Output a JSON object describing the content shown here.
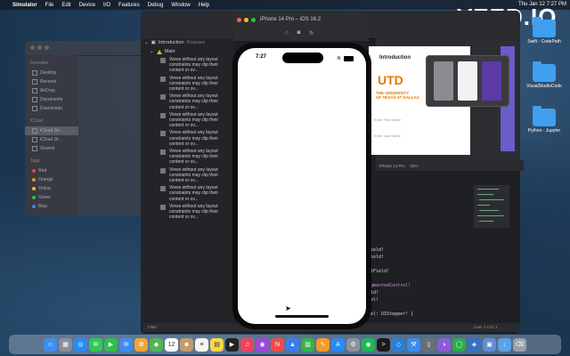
{
  "menubar": {
    "app": "Simulator",
    "items": [
      "File",
      "Edit",
      "Device",
      "I/O",
      "Features",
      "Debug",
      "Window",
      "Help"
    ],
    "datetime": "Thu Jan 12  7:27 PM"
  },
  "watermark": "VEED.IO",
  "finder": {
    "sections": [
      {
        "title": "Favorites",
        "items": [
          "Desktop",
          "Recents",
          "AirDrop",
          "Documents",
          "Downloads"
        ]
      },
      {
        "title": "iCloud",
        "items": [
          "iCloud Dri...",
          "iCloud Dr...",
          "Shared"
        ]
      },
      {
        "title": "Tags",
        "items": [
          "Red",
          "Orange",
          "Yellow",
          "Green",
          "Blue"
        ]
      }
    ],
    "tag_colors": [
      "#e5484d",
      "#f08a24",
      "#e6c229",
      "#3fb950",
      "#3b82f6"
    ]
  },
  "simulator": {
    "title": "iPhone 14 Pro – iOS 16.2",
    "status_time": "7:27"
  },
  "xcode": {
    "issues_header": "Introduction",
    "issues_count": "9 issues",
    "group": "Main",
    "issue_text": "Views without any layout constraints may clip their content or ov...",
    "issue_count_display": 9,
    "preview": {
      "title": "Introduction",
      "logo": "UTD",
      "logo_sub1": "THE UNIVERSITY",
      "logo_sub2": "OF TEXAS AT DALLAS",
      "field1": "Enter First Name",
      "field2": "Enter Last Name"
    },
    "canvas_bar": {
      "device": "iPhone 14 Pro",
      "zoom": "53%"
    },
    "code_lines": [
      "ield!",
      "ield!",
      "tField!",
      "gmentedControl!",
      "ld!",
      "el!",
      "el: UIStepper! {"
    ],
    "statusbar": {
      "filter": "Filter",
      "position": "Line: 1  Col: 1"
    }
  },
  "desktop": [
    {
      "label": "Swift - CodePath"
    },
    {
      "label": "VisualStudioCode"
    },
    {
      "label": "Python - Jupyter"
    }
  ],
  "dock": {
    "apps": [
      {
        "name": "Finder",
        "color": "#3d8ef0",
        "glyph": "☺"
      },
      {
        "name": "Launchpad",
        "color": "#8a8f99",
        "glyph": "▦"
      },
      {
        "name": "Safari",
        "color": "#2a8bf2",
        "glyph": "◎"
      },
      {
        "name": "Messages",
        "color": "#34c759",
        "glyph": "✉"
      },
      {
        "name": "FaceTime",
        "color": "#2fbf4a",
        "glyph": "▶"
      },
      {
        "name": "Mail",
        "color": "#3b8df0",
        "glyph": "✉"
      },
      {
        "name": "Photos",
        "color": "#f2a43a",
        "glyph": "✿"
      },
      {
        "name": "Maps",
        "color": "#52b552",
        "glyph": "◆"
      },
      {
        "name": "Calendar",
        "color": "#ffffff",
        "glyph": "12"
      },
      {
        "name": "Contacts",
        "color": "#c49a6c",
        "glyph": "☻"
      },
      {
        "name": "Reminders",
        "color": "#f5f5f5",
        "glyph": "≡"
      },
      {
        "name": "Notes",
        "color": "#f7d64a",
        "glyph": "▤"
      },
      {
        "name": "TV",
        "color": "#222222",
        "glyph": "▶"
      },
      {
        "name": "Music",
        "color": "#f0435a",
        "glyph": "♫"
      },
      {
        "name": "Podcasts",
        "color": "#a046d8",
        "glyph": "◉"
      },
      {
        "name": "News",
        "color": "#f04a4a",
        "glyph": "N"
      },
      {
        "name": "Keynote",
        "color": "#3a7cf0",
        "glyph": "▲"
      },
      {
        "name": "Numbers",
        "color": "#34b34a",
        "glyph": "▥"
      },
      {
        "name": "Pages",
        "color": "#f39a2c",
        "glyph": "✎"
      },
      {
        "name": "App Store",
        "color": "#2a8bf2",
        "glyph": "A"
      },
      {
        "name": "System Settings",
        "color": "#8d929b",
        "glyph": "⚙"
      },
      {
        "name": "Spotify",
        "color": "#1db954",
        "glyph": "◉"
      },
      {
        "name": "Terminal",
        "color": "#1a1a1a",
        "glyph": ">"
      },
      {
        "name": "Visual Studio Code",
        "color": "#2a7fd4",
        "glyph": "◇"
      },
      {
        "name": "Xcode",
        "color": "#3a8ef0",
        "glyph": "⚒"
      },
      {
        "name": "Simulator",
        "color": "#6a6e78",
        "glyph": "▯"
      },
      {
        "name": "GitHub Desktop",
        "color": "#8e5bd8",
        "glyph": "◑"
      },
      {
        "name": "Anaconda",
        "color": "#2dab4a",
        "glyph": "◯"
      },
      {
        "name": "Python",
        "color": "#3572c4",
        "glyph": "◈"
      },
      {
        "name": "Preview",
        "color": "#5e8fd6",
        "glyph": "▣"
      },
      {
        "name": "Downloads",
        "color": "#5aa3e8",
        "glyph": "↓"
      },
      {
        "name": "Trash",
        "color": "#9aa0aa",
        "glyph": "⌫"
      }
    ]
  }
}
